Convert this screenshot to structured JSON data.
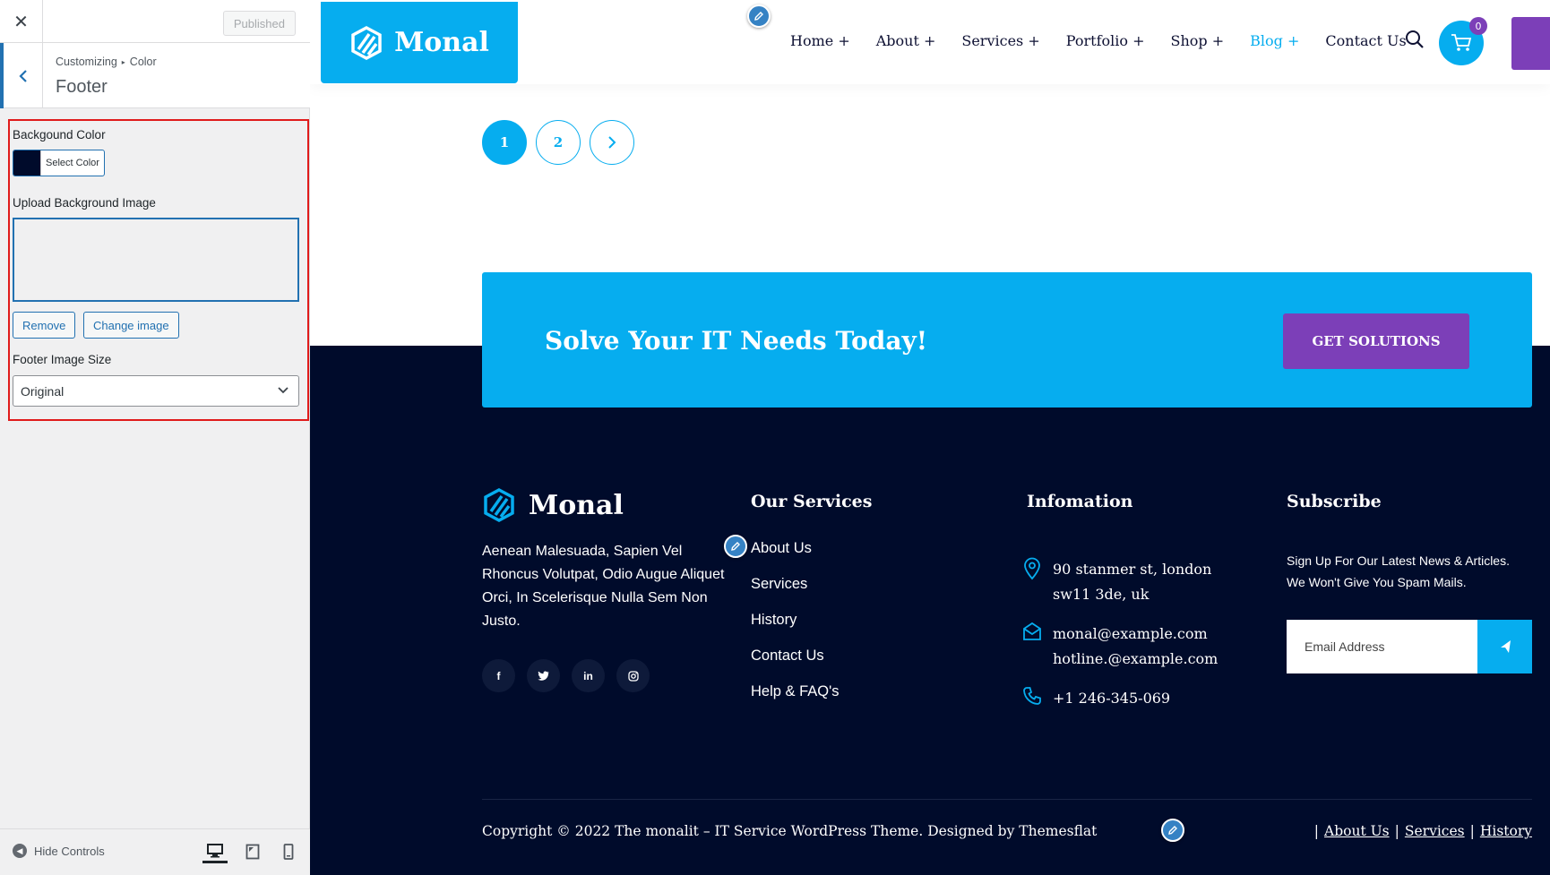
{
  "customizer": {
    "close_icon": "close-icon",
    "published_label": "Published",
    "breadcrumb": {
      "parent": "Customizing",
      "section": "Color"
    },
    "section_title": "Footer",
    "background_color": {
      "label": "Backgound Color",
      "select_label": "Select Color",
      "value": "#000b2b"
    },
    "upload_label": "Upload Background Image",
    "remove_label": "Remove",
    "change_image_label": "Change image",
    "image_size": {
      "label": "Footer Image Size",
      "selected": "Original"
    },
    "hide_controls_label": "Hide Controls",
    "devices": [
      "desktop-icon",
      "tablet-icon",
      "mobile-icon"
    ]
  },
  "site": {
    "brand": "Monal",
    "nav": [
      {
        "label": "Home +",
        "active": false
      },
      {
        "label": "About +",
        "active": false
      },
      {
        "label": "Services +",
        "active": false
      },
      {
        "label": "Portfolio +",
        "active": false
      },
      {
        "label": "Shop +",
        "active": false
      },
      {
        "label": "Blog +",
        "active": true
      },
      {
        "label": "Contact Us",
        "active": false
      }
    ],
    "cart_count": "0",
    "pagination": [
      "1",
      "2"
    ],
    "cta": {
      "title": "Solve Your IT Needs Today!",
      "button": "GET SOLUTIONS"
    },
    "footer": {
      "about": "Aenean Malesuada, Sapien Vel Rhoncus Volutpat, Odio Augue Aliquet Orci, In Scelerisque Nulla Sem Non Justo.",
      "socials": [
        "f",
        "t",
        "in",
        "ig"
      ],
      "services_heading": "Our Services",
      "services": [
        "About Us",
        "Services",
        "History",
        "Contact Us",
        "Help & FAQ's"
      ],
      "info_heading": "Infomation",
      "address_line1": "90 stanmer st, london",
      "address_line2": "sw11 3de, uk",
      "email1": "monal@example.com",
      "email2": "hotline.@example.com",
      "phone": "+1 246-345-069",
      "subscribe_heading": "Subscribe",
      "subscribe_line1": "Sign Up For Our Latest News & Articles.",
      "subscribe_line2": "We Won't Give You Spam Mails.",
      "email_placeholder": "Email Address",
      "copyright": "Copyright © 2022 The monalit – IT Service WordPress Theme. Designed by Themesflat",
      "bottom_links": [
        "About Us",
        "Services",
        "History"
      ]
    }
  },
  "colors": {
    "accent": "#06adef",
    "purple": "#7c3fb8",
    "footer_bg": "#000b2b",
    "wp_blue": "#2271b1"
  }
}
